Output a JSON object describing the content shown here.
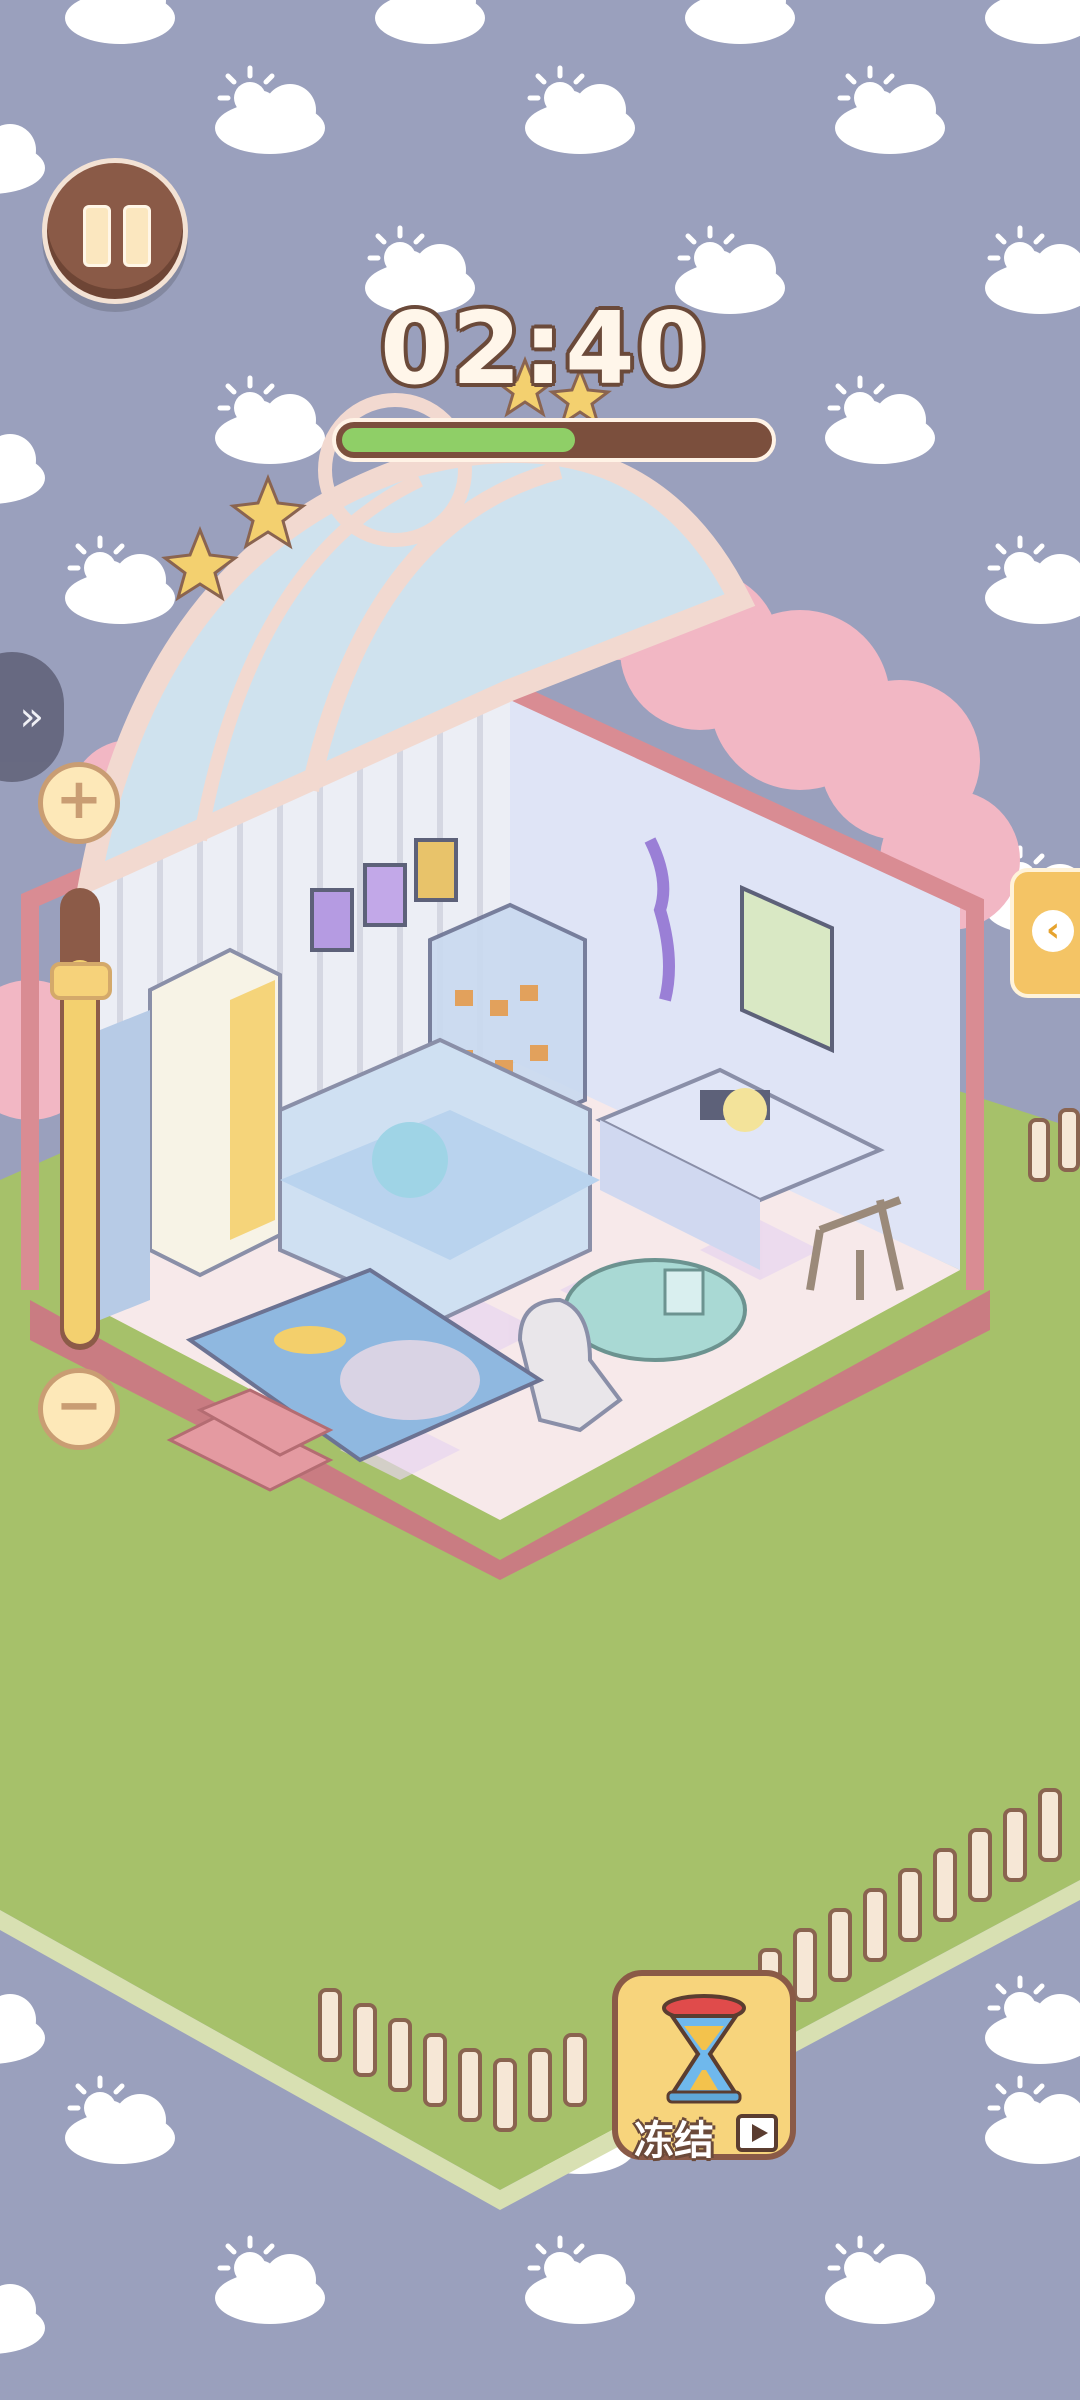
{
  "hud": {
    "timer": "02:40",
    "progress_fraction": 0.55,
    "freeze_label": "冻结"
  },
  "icons": {
    "pause": "pause-icon",
    "expand": "chevron-right-icon",
    "back": "back-arrow-icon",
    "zoom_in": "plus-icon",
    "zoom_out": "minus-icon",
    "freeze": "hourglass-icon",
    "video": "video-ad-icon"
  },
  "colors": {
    "sky": "#9aa0bd",
    "grass": "#a6c16a",
    "progress_fill": "#8fcf67",
    "progress_track": "#7b4f3d",
    "wood": "#8a5a47",
    "accent_yellow": "#f4c465"
  },
  "zoom": {
    "level_fraction": 0.88
  }
}
